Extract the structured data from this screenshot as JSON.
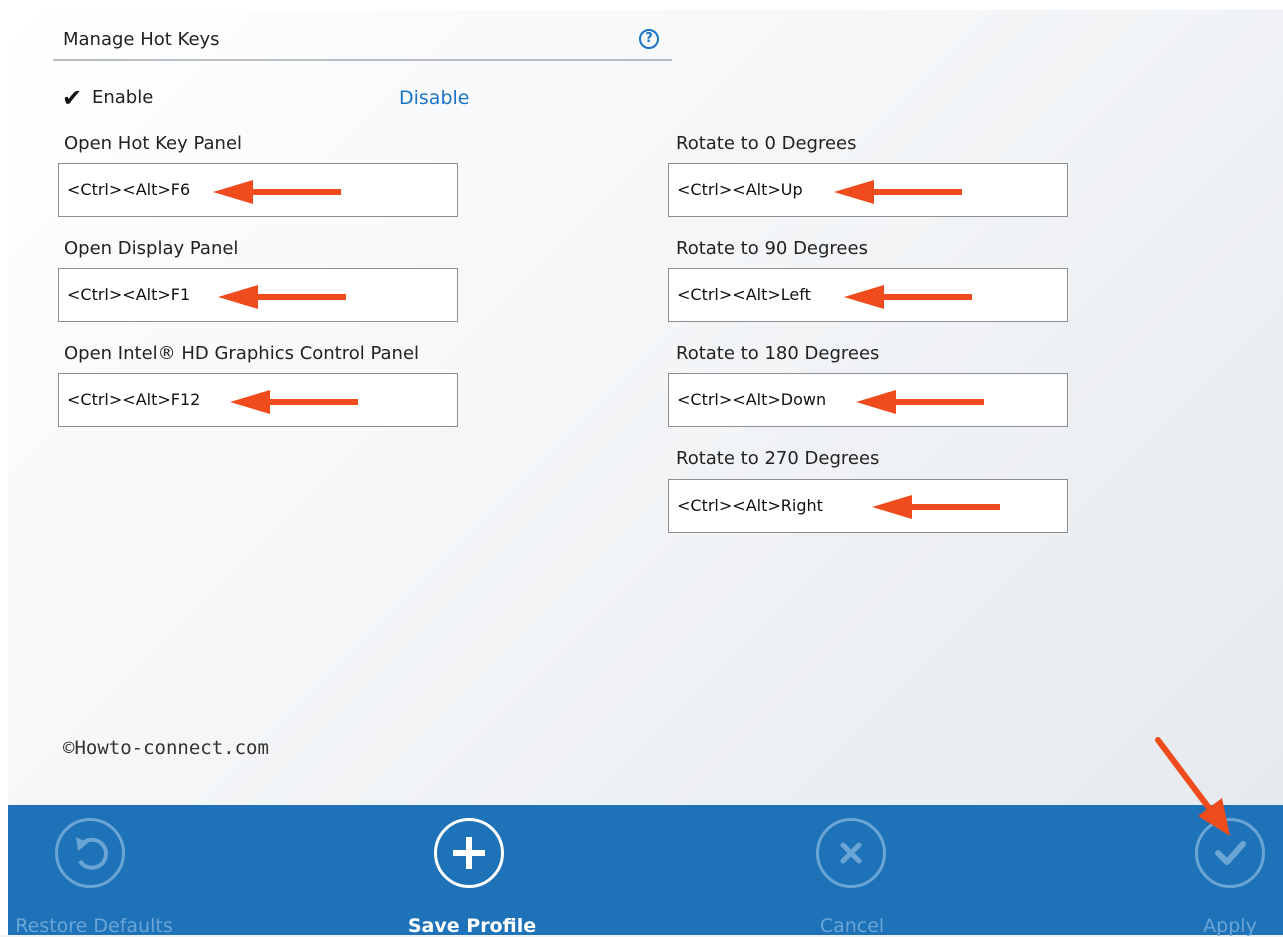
{
  "header": {
    "title": "Manage Hot Keys",
    "help_icon": "question-circle-icon"
  },
  "toggle": {
    "enable_label": "Enable",
    "enable_checked": true,
    "disable_label": "Disable"
  },
  "hotkeys": [
    {
      "label": "Open Hot Key Panel",
      "value": "<Ctrl><Alt>F6"
    },
    {
      "label": "Open Display Panel",
      "value": "<Ctrl><Alt>F1"
    },
    {
      "label": "Open Intel® HD Graphics Control Panel",
      "value": "<Ctrl><Alt>F12"
    },
    {
      "label": "Rotate to 0 Degrees",
      "value": "<Ctrl><Alt>Up"
    },
    {
      "label": "Rotate to 90 Degrees",
      "value": "<Ctrl><Alt>Left"
    },
    {
      "label": "Rotate to 180 Degrees",
      "value": "<Ctrl><Alt>Down"
    },
    {
      "label": "Rotate to 270 Degrees",
      "value": "<Ctrl><Alt>Right"
    }
  ],
  "watermark": "©Howto-connect.com",
  "actions": {
    "restore": {
      "label": "Restore Defaults",
      "icon": "undo-icon",
      "enabled": false
    },
    "save": {
      "label": "Save Profile",
      "icon": "plus-icon",
      "enabled": true
    },
    "cancel": {
      "label": "Cancel",
      "icon": "close-icon",
      "enabled": false
    },
    "apply": {
      "label": "Apply",
      "icon": "checkmark-icon",
      "enabled": false
    }
  },
  "colors": {
    "accent": "#1a73c6",
    "bottom_bar": "#1e72b8",
    "annotation_arrow": "#f04b1c"
  }
}
